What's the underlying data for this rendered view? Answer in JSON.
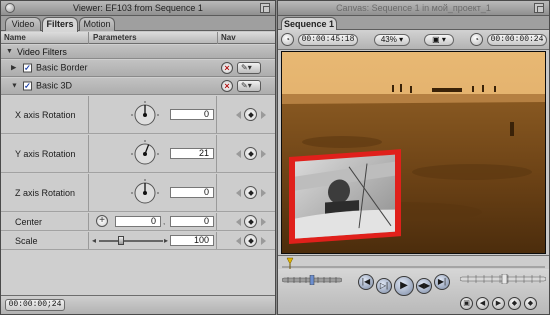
{
  "viewer": {
    "title": "Viewer: EF103 from Sequence 1",
    "tabs": [
      {
        "label": "Video",
        "active": false
      },
      {
        "label": "Filters",
        "active": true
      },
      {
        "label": "Motion",
        "active": false
      }
    ],
    "columns": {
      "name": "Name",
      "parameters": "Parameters",
      "nav": "Nav"
    },
    "section_label": "Video Filters",
    "filters": [
      {
        "label": "Basic Border",
        "enabled": true,
        "expanded": false
      },
      {
        "label": "Basic 3D",
        "enabled": true,
        "expanded": true
      }
    ],
    "params": {
      "x_rotation": {
        "label": "X axis Rotation",
        "value": "0"
      },
      "y_rotation": {
        "label": "Y axis Rotation",
        "value": "21"
      },
      "z_rotation": {
        "label": "Z axis Rotation",
        "value": "0"
      },
      "center": {
        "label": "Center",
        "x": "0",
        "y": "0"
      },
      "scale": {
        "label": "Scale",
        "value": "100",
        "level_fraction": 0.35
      }
    },
    "timecode": "00:00:00;24"
  },
  "canvas": {
    "title": "Canvas: Sequence 1 in мой_проект_1",
    "tab": "Sequence 1",
    "duration": "00:00:45:18",
    "zoom": "43%",
    "current_timecode": "00:00:00:24"
  },
  "colors": {
    "accent_blue": "#1a3fa8",
    "border_red": "#e0201b",
    "sepia": "#8a5a22"
  },
  "icons": {
    "close": "close-circle-icon",
    "remove": "x-icon",
    "keyframe": "keyframe-diamond-icon",
    "play": "play-icon"
  }
}
